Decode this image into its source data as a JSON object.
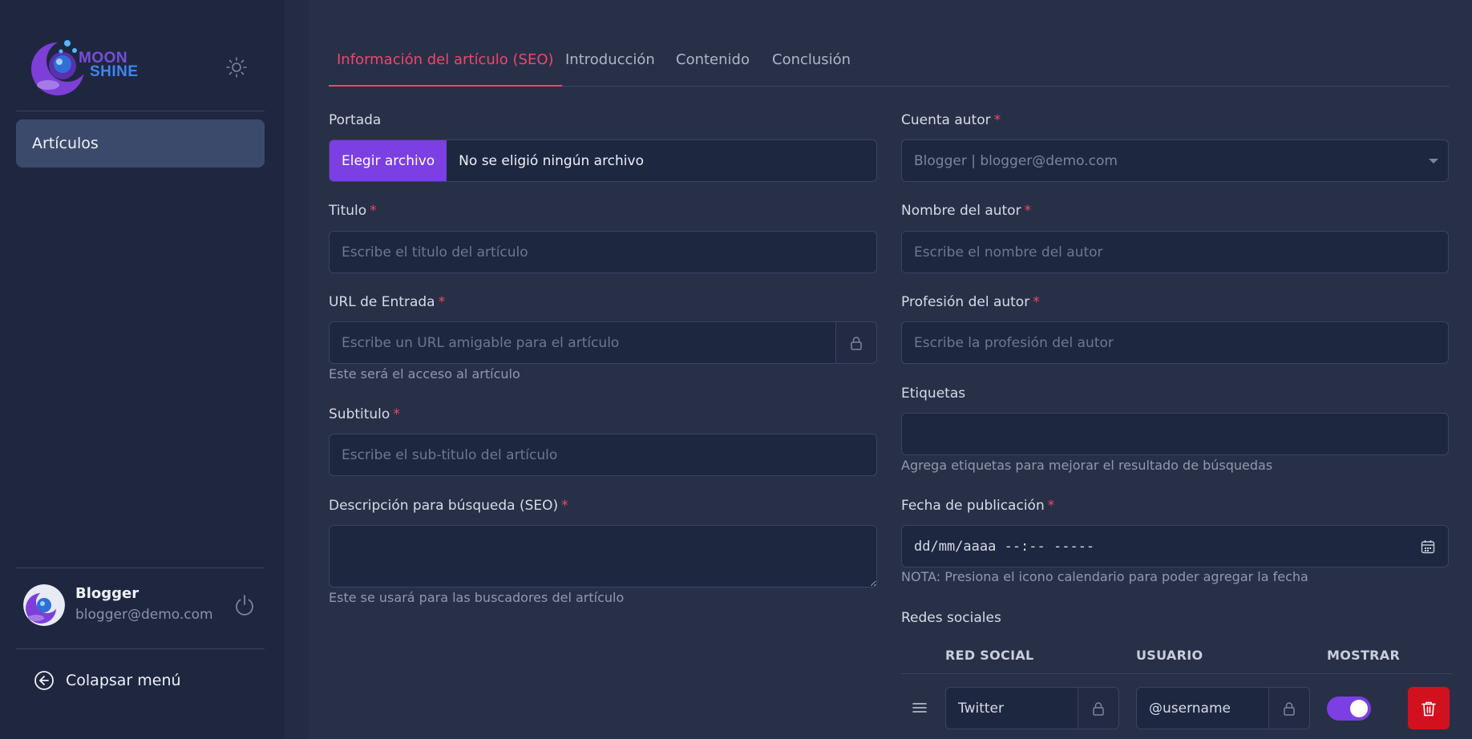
{
  "brand": {
    "line1": "MOON",
    "line2": "SHINE"
  },
  "sidebar": {
    "items": [
      {
        "label": "Artículos"
      }
    ],
    "user": {
      "name": "Blogger",
      "email": "blogger@demo.com"
    },
    "collapse_label": "Colapsar menú"
  },
  "tabs": [
    {
      "label": "Información del artículo (SEO)"
    },
    {
      "label": "Introducción"
    },
    {
      "label": "Contenido"
    },
    {
      "label": "Conclusión"
    }
  ],
  "form": {
    "cover": {
      "label": "Portada",
      "button": "Elegir archivo",
      "status": "No se eligió ningún archivo"
    },
    "title": {
      "label": "Titulo",
      "required": "*",
      "placeholder": "Escribe el titulo del artículo"
    },
    "url": {
      "label": "URL de Entrada",
      "required": "*",
      "placeholder": "Escribe un URL amigable para el artículo",
      "help": "Este será el acceso al artículo"
    },
    "subtitle": {
      "label": "Subtitulo",
      "required": "*",
      "placeholder": "Escribe el sub-titulo del artículo"
    },
    "seo_description": {
      "label": "Descripción para búsqueda (SEO)",
      "required": "*",
      "help": "Este se usará para las buscadores del artículo"
    },
    "author_account": {
      "label": "Cuenta autor",
      "required": "*",
      "value": "Blogger | blogger@demo.com"
    },
    "author_name": {
      "label": "Nombre del autor",
      "required": "*",
      "placeholder": "Escribe el nombre del autor"
    },
    "author_profession": {
      "label": "Profesión del autor",
      "required": "*",
      "placeholder": "Escribe la profesión del autor"
    },
    "tags": {
      "label": "Etiquetas",
      "help": "Agrega etiquetas para mejorar el resultado de búsquedas"
    },
    "publish_date": {
      "label": "Fecha de publicación",
      "required": "*",
      "value": "dd/mm/aaaa --:-- -----",
      "help": "NOTA: Presiona el icono calendario para poder agregar la fecha"
    },
    "social": {
      "label": "Redes sociales",
      "headers": [
        "RED SOCIAL",
        "USUARIO",
        "MOSTRAR"
      ],
      "rows": [
        {
          "network": "Twitter",
          "user_placeholder": "@username",
          "show": true
        }
      ]
    }
  },
  "colors": {
    "accent": "#f0456a",
    "primary": "#7b3fe4",
    "danger": "#d1121e"
  },
  "icons": [
    "sun-icon",
    "power-icon",
    "arrow-left-circle-icon",
    "lock-icon",
    "calendar-icon",
    "drag-handle-icon",
    "trash-icon"
  ]
}
